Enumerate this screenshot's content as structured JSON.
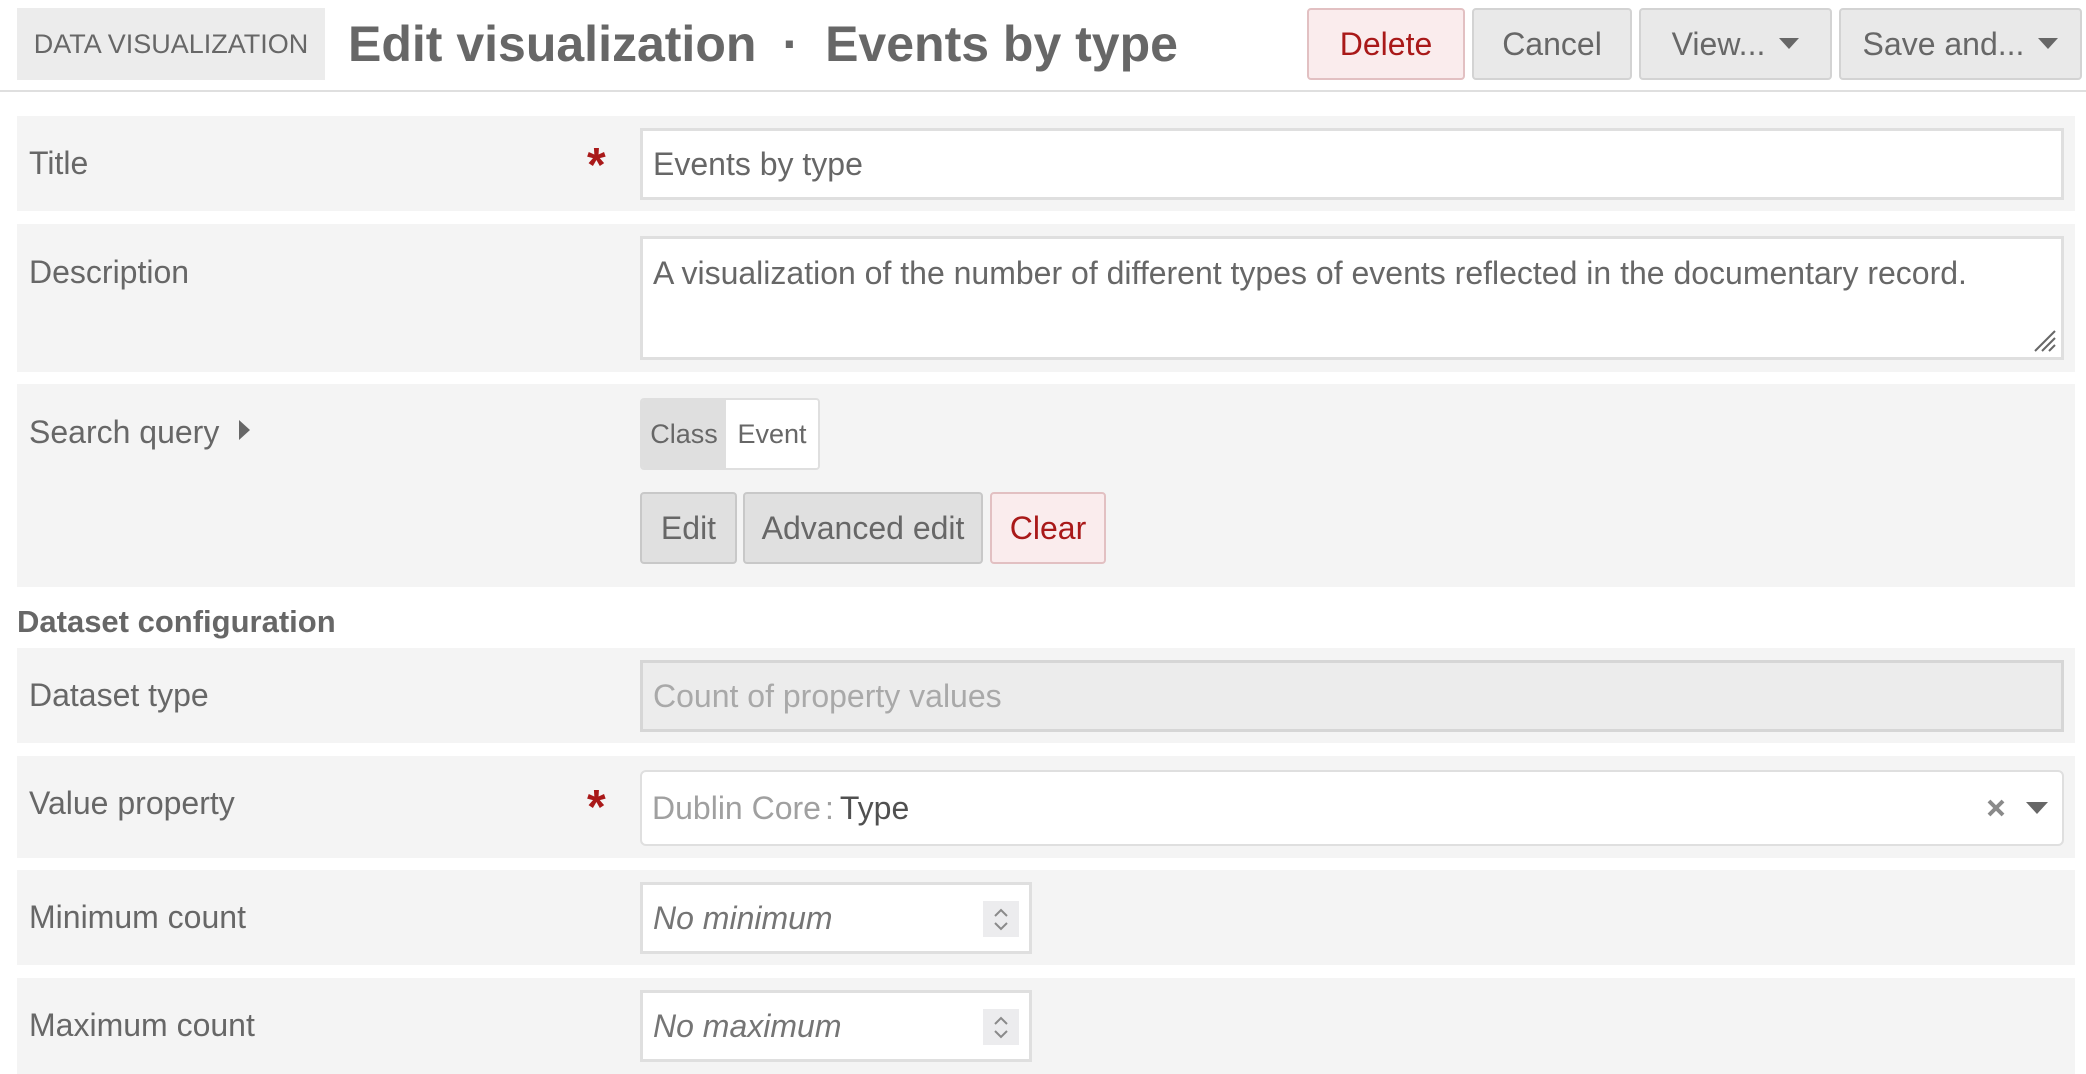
{
  "header": {
    "section_badge": "DATA VISUALIZATION",
    "title_prefix": "Edit visualization",
    "title_separator": "·",
    "title_name": "Events by type",
    "buttons": {
      "delete": "Delete",
      "cancel": "Cancel",
      "view": "View...",
      "save": "Save and..."
    }
  },
  "form": {
    "title": {
      "label": "Title",
      "required_marker": "*",
      "value": "Events by type"
    },
    "description": {
      "label": "Description",
      "value": "A visualization of the number of different types of events reflected in the documentary record."
    },
    "search_query": {
      "label": "Search query",
      "filter_key": "Class",
      "filter_value": "Event",
      "buttons": {
        "edit": "Edit",
        "advanced_edit": "Advanced edit",
        "clear": "Clear"
      }
    },
    "dataset_section_heading": "Dataset configuration",
    "dataset_type": {
      "label": "Dataset type",
      "value": "Count of property values"
    },
    "value_property": {
      "label": "Value property",
      "required_marker": "*",
      "vocabulary": "Dublin Core",
      "separator": ":",
      "property": "Type"
    },
    "minimum_count": {
      "label": "Minimum count",
      "value": "",
      "placeholder": "No minimum"
    },
    "maximum_count": {
      "label": "Maximum count",
      "value": "",
      "placeholder": "No maximum"
    }
  },
  "colors": {
    "danger": "#a91919",
    "danger_bg": "#faeced",
    "text": "#676767",
    "row_bg": "#f4f4f4"
  }
}
